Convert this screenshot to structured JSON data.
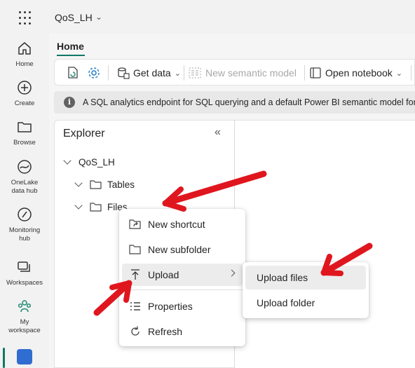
{
  "workspace": {
    "name": "QoS_LH"
  },
  "rail": {
    "items": [
      {
        "label": "Home",
        "icon": "home-icon"
      },
      {
        "label": "Create",
        "icon": "plus-circle-icon"
      },
      {
        "label": "Browse",
        "icon": "folder-icon"
      },
      {
        "label": "OneLake\ndata hub",
        "label1": "OneLake",
        "label2": "data hub",
        "icon": "onelake-icon"
      },
      {
        "label": "Monitoring hub",
        "label1": "Monitoring",
        "label2": "hub",
        "icon": "monitoring-icon"
      },
      {
        "label": "Workspaces",
        "icon": "workspaces-icon"
      },
      {
        "label": "My workspace",
        "label1": "My",
        "label2": "workspace",
        "icon": "my-workspace-icon"
      }
    ]
  },
  "tabs": {
    "home": "Home"
  },
  "ribbon": {
    "get_data": "Get data",
    "new_semantic_model": "New semantic model",
    "open_notebook": "Open notebook"
  },
  "banner": {
    "text": "A SQL analytics endpoint for SQL querying and a default Power BI semantic model for repo"
  },
  "explorer": {
    "title": "Explorer",
    "root": "QoS_LH",
    "items": [
      {
        "label": "Tables"
      },
      {
        "label": "Files"
      }
    ]
  },
  "context_menu": {
    "items": [
      {
        "label": "New shortcut",
        "icon": "shortcut-icon"
      },
      {
        "label": "New subfolder",
        "icon": "folder-icon"
      },
      {
        "label": "Upload",
        "icon": "upload-icon",
        "highlighted": true
      },
      {
        "label": "Properties",
        "icon": "properties-icon"
      },
      {
        "label": "Refresh",
        "icon": "refresh-icon"
      }
    ]
  },
  "submenu": {
    "items": [
      {
        "label": "Upload files",
        "highlighted": true
      },
      {
        "label": "Upload folder"
      }
    ]
  },
  "colors": {
    "accent": "#117865",
    "annotation_arrow": "#e0161e"
  }
}
